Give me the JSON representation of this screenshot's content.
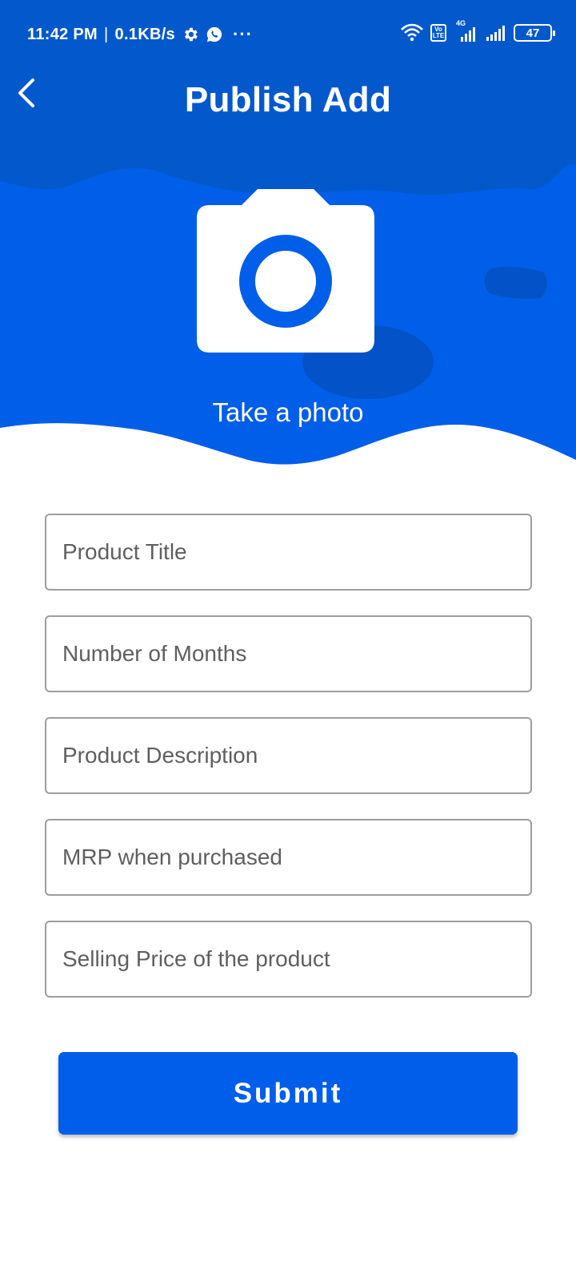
{
  "colors": {
    "header_blue": "#0359cc",
    "hero_blue": "#005ee8",
    "blob_blue": "#0352c7",
    "button_blue": "#005eeb",
    "white": "#ffffff",
    "field_border": "#9e9e9e",
    "placeholder_text": "#5f5f5f"
  },
  "status_bar": {
    "time": "11:42 PM",
    "separator": "|",
    "network_speed": "0.1KB/s",
    "left_icons": [
      "settings-gear-icon",
      "whatsapp-icon",
      "more-dots-icon"
    ],
    "more_dots": "···",
    "right_icons": [
      "wifi-icon",
      "volte-icon",
      "signal-4g-icon",
      "signal-icon",
      "battery-icon"
    ],
    "volte_top": "Vo",
    "volte_bottom": "LTE",
    "network_type": "4G",
    "battery_level": "47"
  },
  "header": {
    "back_icon": "chevron-left-icon",
    "title": "Publish Add"
  },
  "photo": {
    "icon": "camera-icon",
    "label": "Take a photo"
  },
  "form": {
    "fields": [
      {
        "placeholder": "Product Title",
        "value": ""
      },
      {
        "placeholder": "Number of Months",
        "value": ""
      },
      {
        "placeholder": "Product Description",
        "value": ""
      },
      {
        "placeholder": "MRP when purchased",
        "value": ""
      },
      {
        "placeholder": "Selling Price of the product",
        "value": ""
      }
    ],
    "submit_label": "Submit"
  }
}
